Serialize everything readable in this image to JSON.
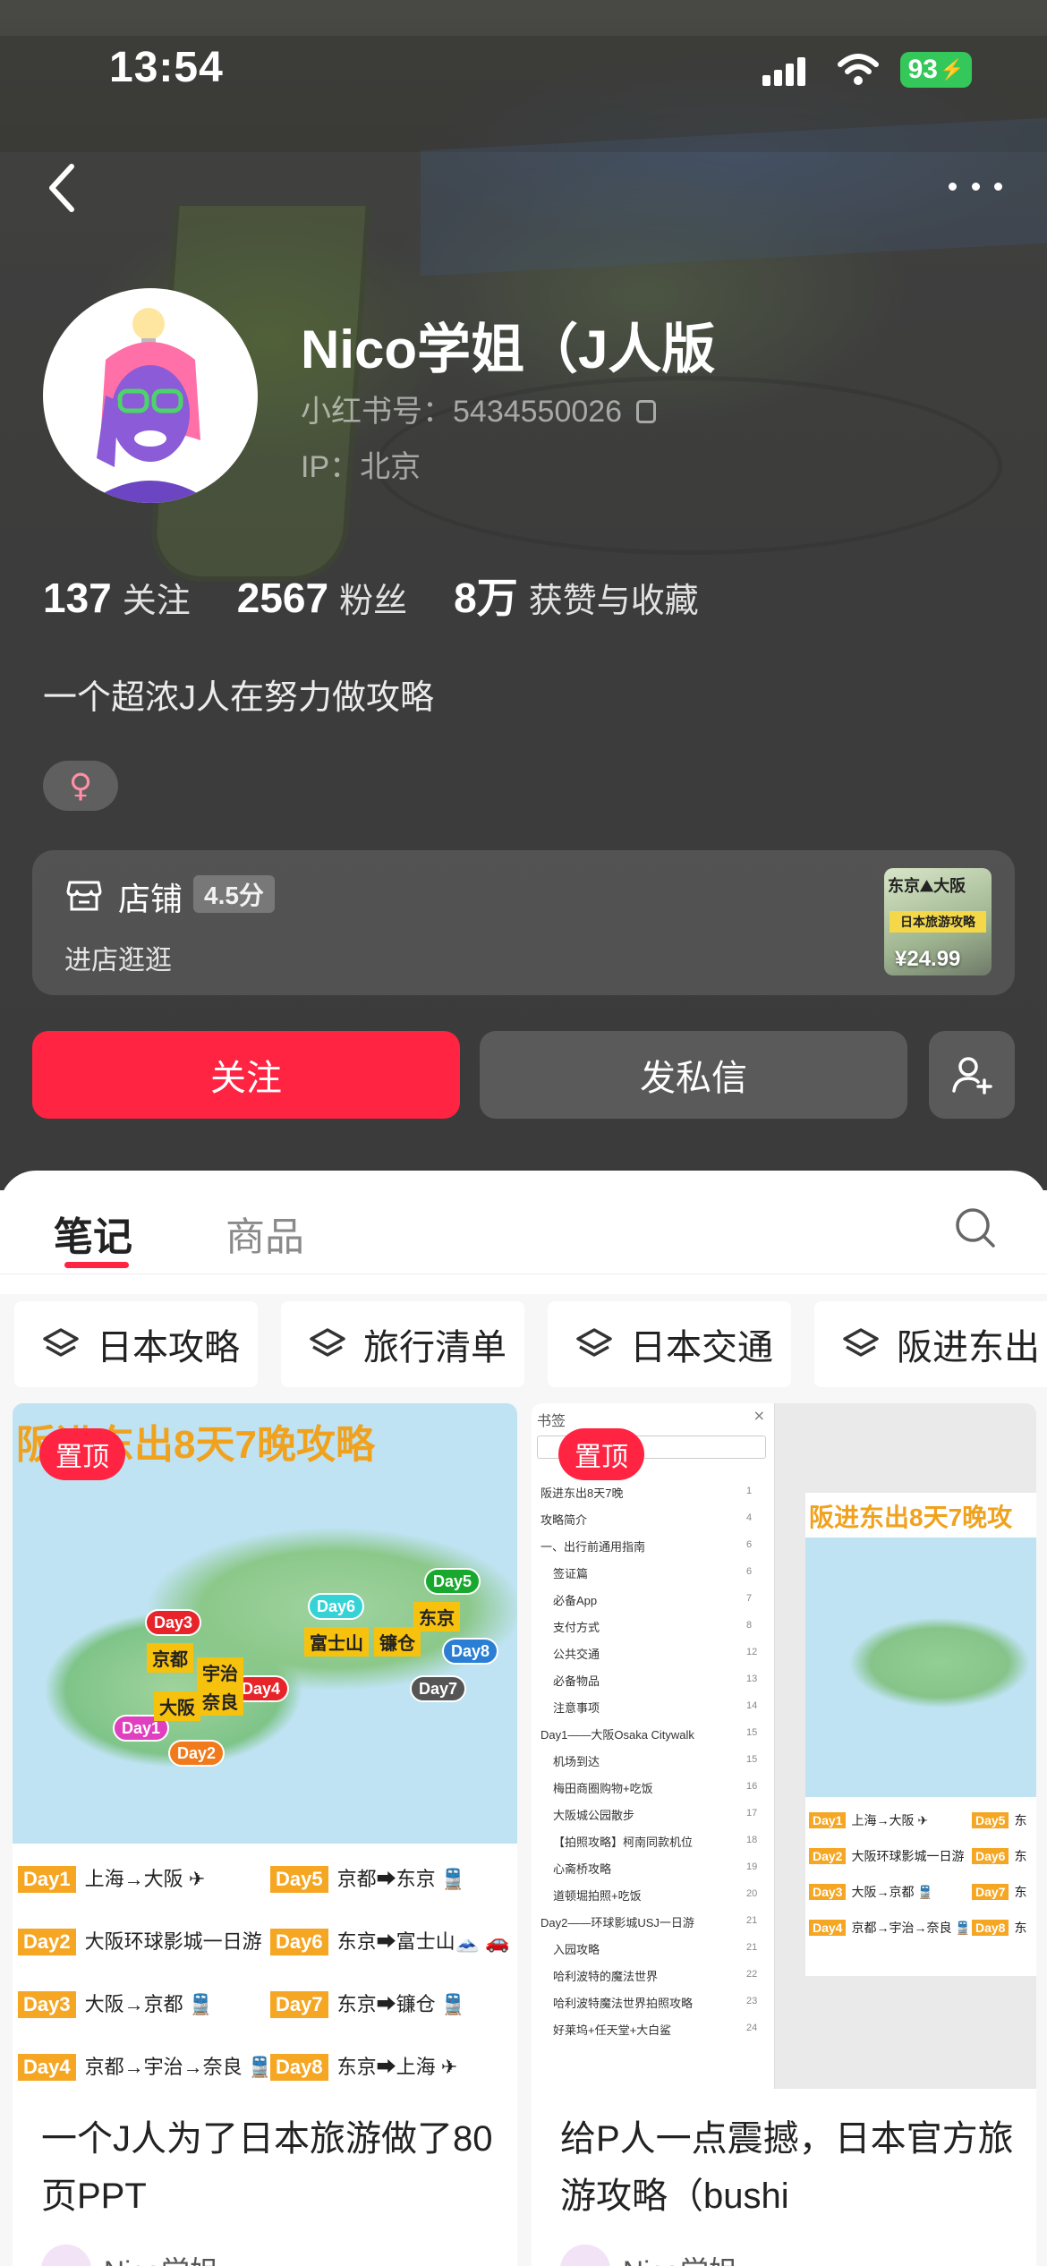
{
  "status_bar": {
    "time": "13:54",
    "battery": "93"
  },
  "profile": {
    "name": "Nico学姐（J人版",
    "red_id": "小红书号：5434550026",
    "ip": "IP：北京",
    "stats": [
      {
        "value": "137",
        "label": "关注"
      },
      {
        "value": "2567",
        "label": "粉丝"
      },
      {
        "value": "8万",
        "label": "获赞与收藏"
      }
    ],
    "bio": "一个超浓J人在努力做攻略",
    "gender_symbol": "♀"
  },
  "shop": {
    "title": "店铺",
    "score": "4.5分",
    "enter": "进店逛逛",
    "thumb_text_1": "东京⛰大阪",
    "thumb_text_2": "日本旅游攻略",
    "price": "¥24.99"
  },
  "actions": {
    "follow": "关注",
    "message": "发私信"
  },
  "tabs": {
    "notes": "笔记",
    "goods": "商品"
  },
  "collections": [
    "日本攻略",
    "旅行清单",
    "日本交通",
    "阪进东出"
  ],
  "notes": [
    {
      "pin": "置顶",
      "image_title": "阪进东出8天7晚攻略",
      "map_pins": [
        "Day3",
        "Day6",
        "Day5",
        "Day4",
        "Day7",
        "Day8",
        "Day1",
        "Day2"
      ],
      "map_cities": [
        "京都",
        "宇治",
        "奈良",
        "大阪",
        "富士山",
        "镰仓",
        "东京"
      ],
      "days": [
        {
          "day": "Day1",
          "text": "上海→大阪 ✈"
        },
        {
          "day": "Day2",
          "text": "大阪环球影城一日游"
        },
        {
          "day": "Day3",
          "text": "大阪→京都 🚆"
        },
        {
          "day": "Day4",
          "text": "京都→宇治→奈良 🚆"
        },
        {
          "day": "Day5",
          "text": "京都➡东京 🚆"
        },
        {
          "day": "Day6",
          "text": "东京➡富士山🗻 🚗"
        },
        {
          "day": "Day7",
          "text": "东京➡镰仓 🚆"
        },
        {
          "day": "Day8",
          "text": "东京➡上海 ✈"
        }
      ],
      "title": "一个J人为了日本旅游做了80页PPT",
      "author": "Nico学姐"
    },
    {
      "pin": "置顶",
      "toc_header": "书签",
      "toc": [
        {
          "text": "阪进东出8天7晚",
          "num": "1"
        },
        {
          "text": "攻略简介",
          "num": "4"
        },
        {
          "text": "一、出行前通用指南",
          "num": "6"
        },
        {
          "text": "签证篇",
          "num": "6"
        },
        {
          "text": "必备App",
          "num": "7"
        },
        {
          "text": "支付方式",
          "num": "8"
        },
        {
          "text": "公共交通",
          "num": "12"
        },
        {
          "text": "必备物品",
          "num": "13"
        },
        {
          "text": "注意事项",
          "num": "14"
        },
        {
          "text": "Day1——大阪Osaka Citywalk",
          "num": "15"
        },
        {
          "text": "机场到达",
          "num": "15"
        },
        {
          "text": "梅田商圈购物+吃饭",
          "num": "16"
        },
        {
          "text": "大阪城公园散步",
          "num": "17"
        },
        {
          "text": "【拍照攻略】柯南同款机位",
          "num": "18"
        },
        {
          "text": "心斋桥攻略",
          "num": "19"
        },
        {
          "text": "道顿堀拍照+吃饭",
          "num": "20"
        },
        {
          "text": "Day2——环球影城USJ一日游",
          "num": "21"
        },
        {
          "text": "入园攻略",
          "num": "21"
        },
        {
          "text": "哈利波特的魔法世界",
          "num": "22"
        },
        {
          "text": "哈利波特魔法世界拍照攻略",
          "num": "23"
        },
        {
          "text": "好莱坞+任天堂+大白鲨",
          "num": "24"
        }
      ],
      "slide_title": "阪进东出8天7晚攻",
      "slide_days": [
        {
          "day": "Day1",
          "text": "上海→大阪 ✈"
        },
        {
          "day": "Day2",
          "text": "大阪环球影城一日游"
        },
        {
          "day": "Day3",
          "text": "大阪→京都 🚆"
        },
        {
          "day": "Day4",
          "text": "京都→宇治→奈良 🚆"
        },
        {
          "day": "Day5",
          "text": "东"
        },
        {
          "day": "Day6",
          "text": "东"
        },
        {
          "day": "Day7",
          "text": "东"
        },
        {
          "day": "Day8",
          "text": "东"
        }
      ],
      "title": "给P人一点震撼，日本官方旅游攻略（bushi",
      "author": "Nico学姐"
    }
  ],
  "colors": {
    "accent": "#ff2442",
    "battery": "#34c759",
    "label_orange": "#f5a623",
    "title_orange": "#f0a21f"
  }
}
